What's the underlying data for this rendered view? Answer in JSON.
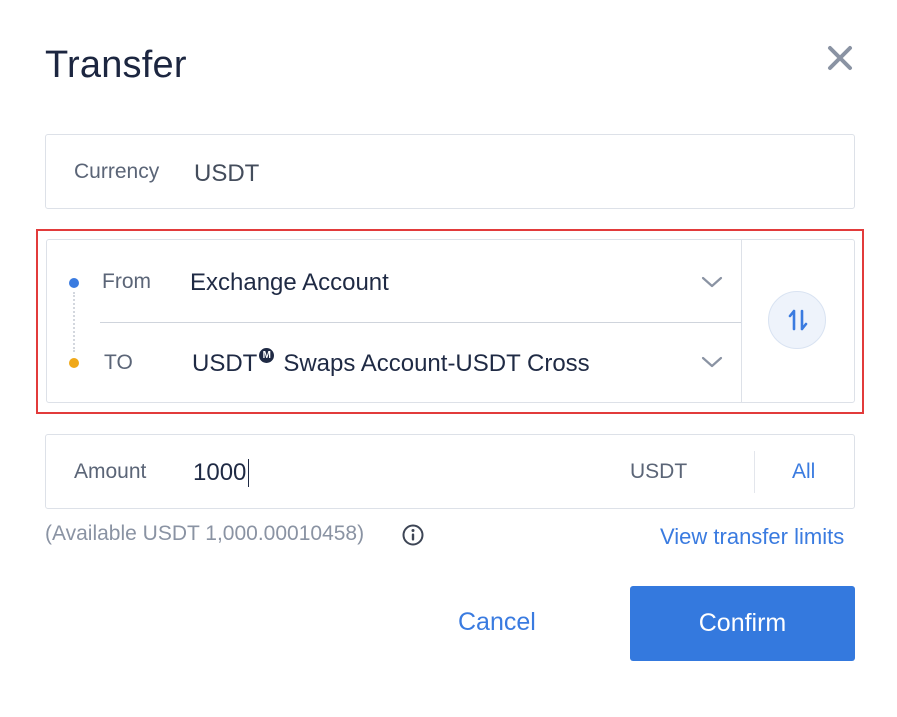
{
  "dialog": {
    "title": "Transfer",
    "close_icon": "close-icon"
  },
  "currency": {
    "label": "Currency",
    "value": "USDT"
  },
  "from": {
    "label": "From",
    "value": "Exchange Account",
    "dot_color": "#3a7be0"
  },
  "to": {
    "label": "TO",
    "prefix": "USDT",
    "badge": "M",
    "value": "Swaps Account-USDT Cross",
    "dot_color": "#f0a818"
  },
  "swap": {
    "icon": "swap-arrows-icon"
  },
  "amount": {
    "label": "Amount",
    "value": "1000",
    "unit": "USDT",
    "all_label": "All"
  },
  "available": {
    "text": "(Available USDT 1,000.00010458)",
    "icon": "info-icon"
  },
  "links": {
    "limits": "View transfer limits"
  },
  "actions": {
    "cancel": "Cancel",
    "confirm": "Confirm"
  },
  "colors": {
    "accent": "#3479de",
    "highlight": "#e23b3b"
  }
}
